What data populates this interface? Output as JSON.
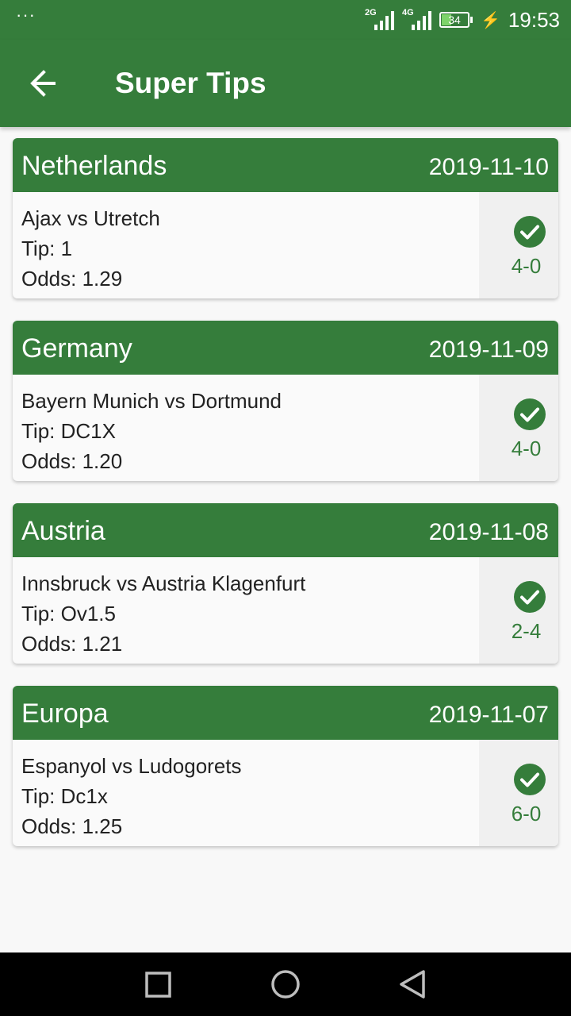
{
  "status_bar": {
    "dots": "···",
    "net1": "2G",
    "net2": "4G",
    "battery": "34",
    "time": "19:53"
  },
  "app_bar": {
    "title": "Super Tips",
    "back_icon": "arrow-back-icon"
  },
  "tips": [
    {
      "country": "Netherlands",
      "date": "2019-11-10",
      "match": "Ajax vs Utretch",
      "tip": "Tip: 1",
      "odds": "Odds: 1.29",
      "score": "4-0",
      "status_icon": "check-circle-icon"
    },
    {
      "country": "Germany",
      "date": "2019-11-09",
      "match": "Bayern Munich vs Dortmund",
      "tip": "Tip: DC1X",
      "odds": "Odds: 1.20",
      "score": "4-0",
      "status_icon": "check-circle-icon"
    },
    {
      "country": "Austria",
      "date": "2019-11-08",
      "match": "Innsbruck vs Austria Klagenfurt",
      "tip": "Tip: Ov1.5",
      "odds": "Odds: 1.21",
      "score": "2-4",
      "status_icon": "check-circle-icon"
    },
    {
      "country": "Europa",
      "date": "2019-11-07",
      "match": "Espanyol vs Ludogorets",
      "tip": "Tip: Dc1x",
      "odds": "Odds: 1.25",
      "score": "6-0",
      "status_icon": "check-circle-icon"
    }
  ],
  "colors": {
    "primary": "#357d3b",
    "background": "#f8f8f8",
    "result_panel": "#f0f0f0"
  },
  "nav_bar": {
    "icons": [
      "square-recents-icon",
      "circle-home-icon",
      "triangle-back-icon"
    ]
  }
}
